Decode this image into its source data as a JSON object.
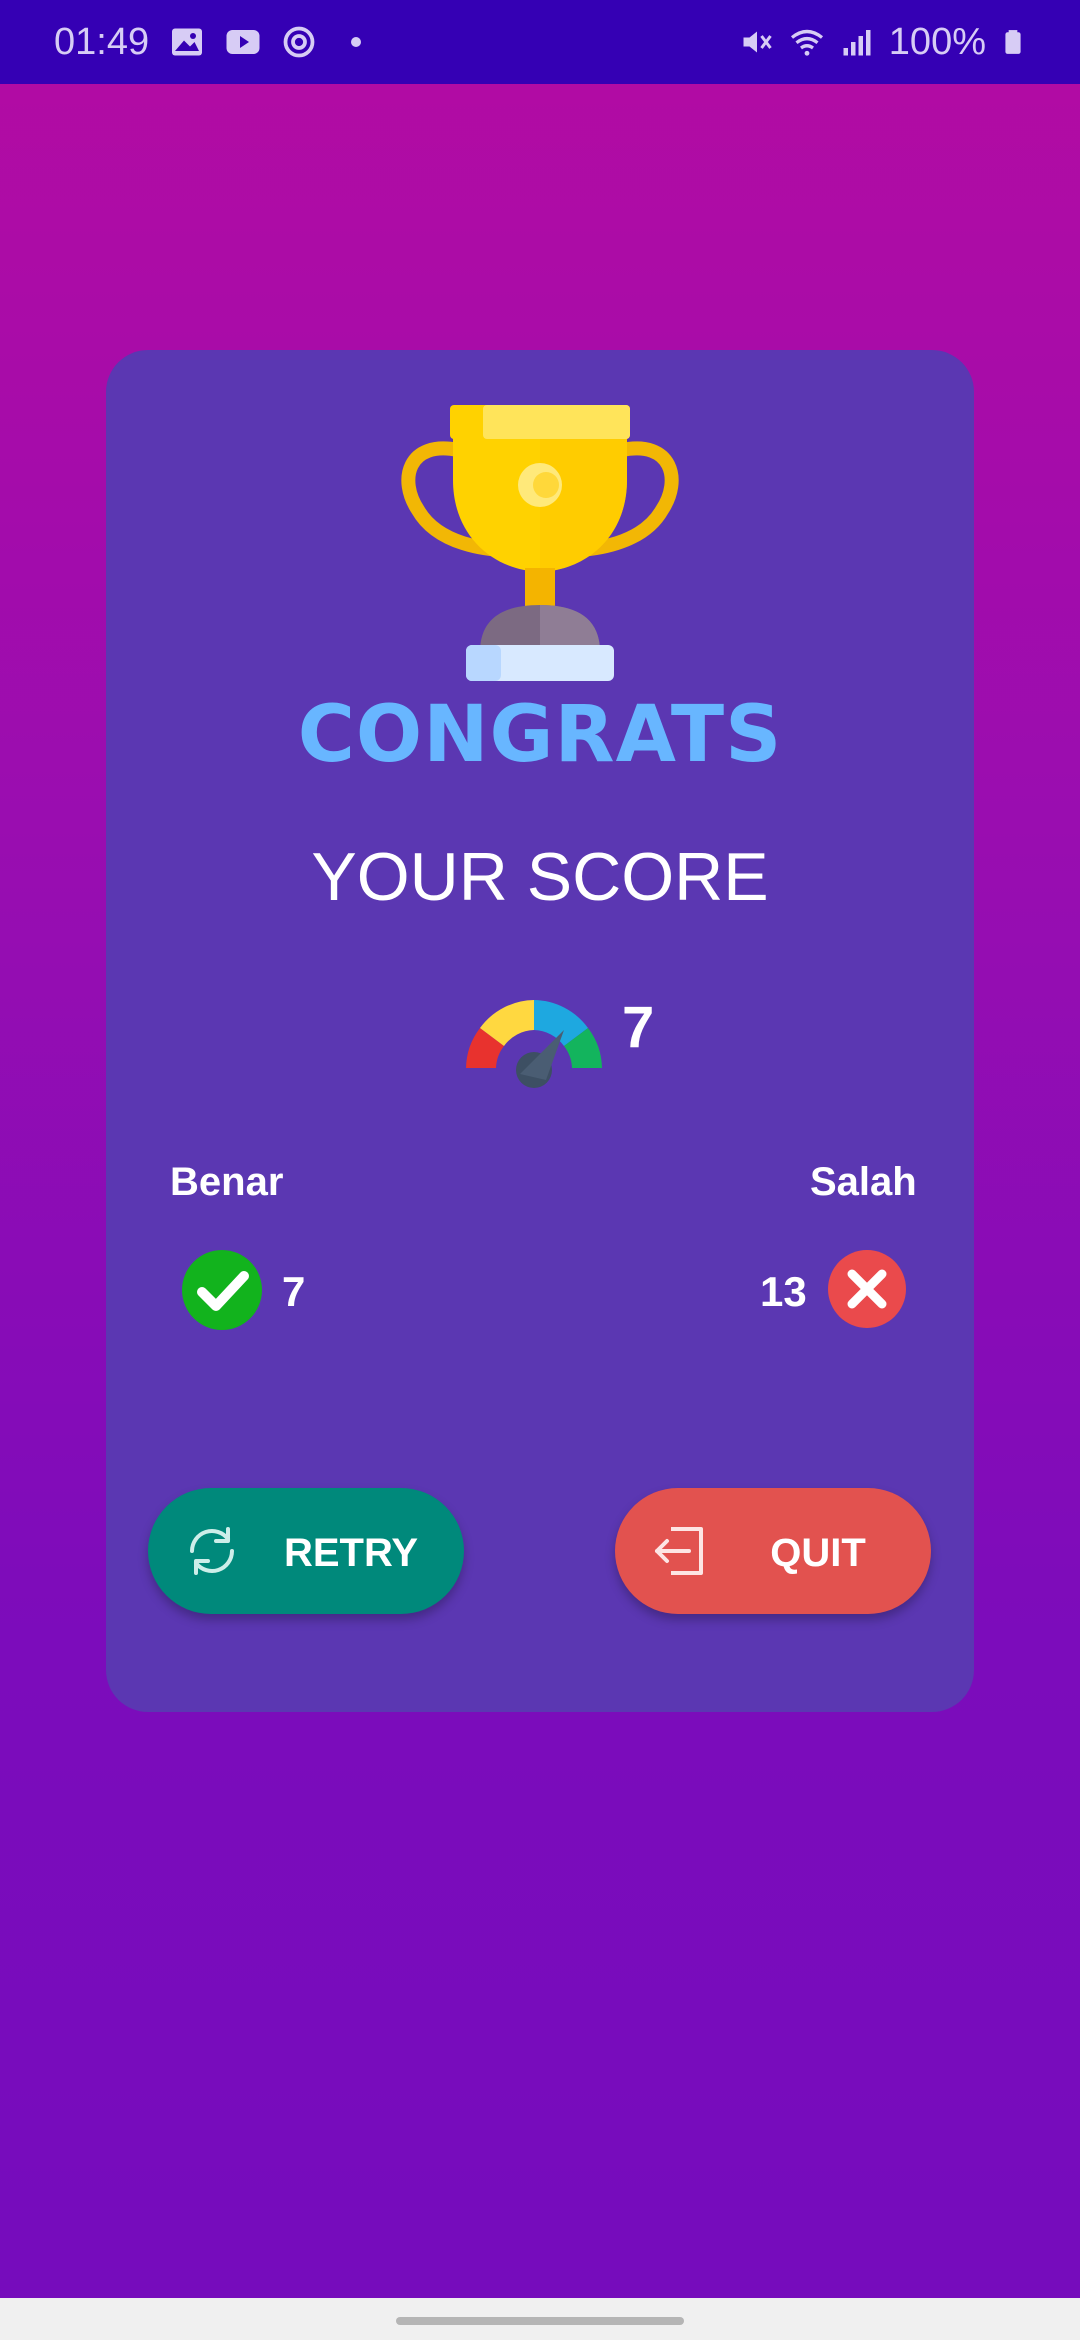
{
  "status_bar": {
    "time": "01:49",
    "icons": [
      "image-icon",
      "youtube-icon",
      "sync-icon",
      "dot-icon"
    ],
    "right_icons": [
      "mute-icon",
      "wifi-icon",
      "signal-icon",
      "battery-icon"
    ],
    "battery": "100%"
  },
  "result": {
    "title": "CONGRATS",
    "score_label": "YOUR SCORE",
    "score_value": "7",
    "correct_label": "Benar",
    "correct_count": "7",
    "wrong_label": "Salah",
    "wrong_count": "13"
  },
  "buttons": {
    "retry_label": "RETRY",
    "quit_label": "QUIT"
  },
  "colors": {
    "status_bar": "#3500b4",
    "card": "#5b37b2",
    "congrats": "#68b6ff",
    "retry": "#00897b",
    "quit": "#e2524f",
    "correct": "#12b31d",
    "wrong": "#ea4a4c"
  }
}
